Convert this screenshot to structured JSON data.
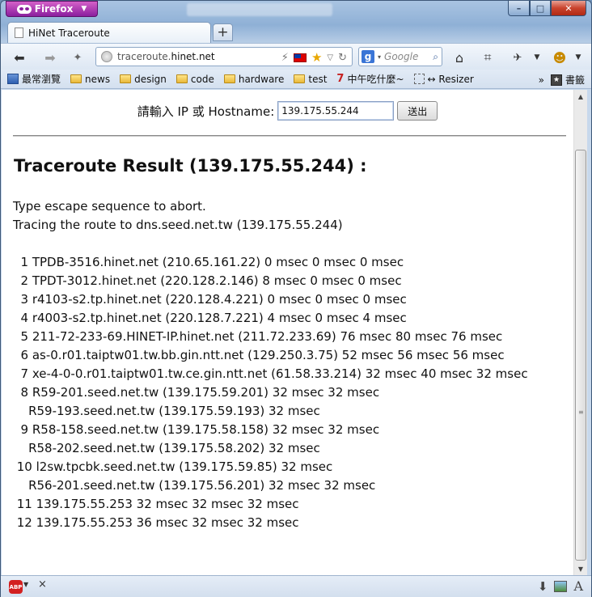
{
  "browser": {
    "menu_label": "Firefox",
    "tab_title": "HiNet Traceroute",
    "new_tab": "+",
    "url_prefix": "traceroute.",
    "url_domain": "hinet.net",
    "search_placeholder": "Google"
  },
  "bookmarks": {
    "items": [
      "最常瀏覽",
      "news",
      "design",
      "code",
      "hardware",
      "test",
      "中午吃什麼~",
      "↔ Resizer"
    ],
    "overflow": "»",
    "bookmarks_menu": "書籤"
  },
  "form": {
    "label": "請輸入 IP 或 Hostname:",
    "input_value": "139.175.55.244",
    "submit_label": "送出"
  },
  "result": {
    "title": "Traceroute Result (139.175.55.244) :",
    "lines": [
      "Type escape sequence to abort.",
      "Tracing the route to dns.seed.net.tw (139.175.55.244)",
      "",
      "  1 TPDB-3516.hinet.net (210.65.161.22) 0 msec 0 msec 0 msec",
      "  2 TPDT-3012.hinet.net (220.128.2.146) 8 msec 0 msec 0 msec",
      "  3 r4103-s2.tp.hinet.net (220.128.4.221) 0 msec 0 msec 0 msec",
      "  4 r4003-s2.tp.hinet.net (220.128.7.221) 4 msec 0 msec 4 msec",
      "  5 211-72-233-69.HINET-IP.hinet.net (211.72.233.69) 76 msec 80 msec 76 msec",
      "  6 as-0.r01.taiptw01.tw.bb.gin.ntt.net (129.250.3.75) 52 msec 56 msec 56 msec",
      "  7 xe-4-0-0.r01.taiptw01.tw.ce.gin.ntt.net (61.58.33.214) 32 msec 40 msec 32 msec",
      "  8 R59-201.seed.net.tw (139.175.59.201) 32 msec 32 msec",
      "    R59-193.seed.net.tw (139.175.59.193) 32 msec",
      "  9 R58-158.seed.net.tw (139.175.58.158) 32 msec 32 msec",
      "    R58-202.seed.net.tw (139.175.58.202) 32 msec",
      " 10 l2sw.tpcbk.seed.net.tw (139.175.59.85) 32 msec",
      "    R56-201.seed.net.tw (139.175.56.201) 32 msec 32 msec",
      " 11 139.175.55.253 32 msec 32 msec 32 msec",
      " 12 139.175.55.253 36 msec 32 msec 32 msec"
    ]
  },
  "statusbar": {
    "abp_label": "ABP",
    "close": "×"
  }
}
